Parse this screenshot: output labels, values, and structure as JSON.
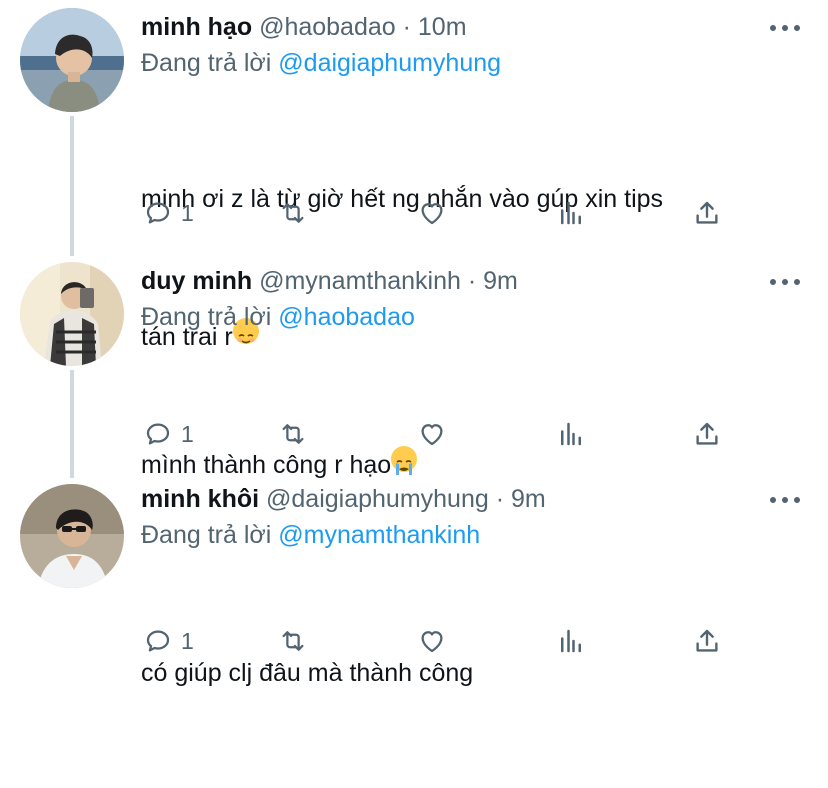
{
  "tweets": [
    {
      "name": "minh hạo",
      "handle": "@haobadao",
      "dot": "·",
      "time": "10m",
      "reply_prefix": "Đang trả lời ",
      "reply_to": "@daigiaphumyhung",
      "text_line1": "minh ơi z là từ giờ hết ng nhắn vào gúp xin tips",
      "text_line2": "tán trai r",
      "emoji": "relieved-face",
      "reply_count": "1"
    },
    {
      "name": "duy minh",
      "handle": "@mynamthankinh",
      "dot": "·",
      "time": "9m",
      "reply_prefix": "Đang trả lời ",
      "reply_to": "@haobadao",
      "text_line1": "mình thành công r hạo",
      "emoji": "crying-face",
      "reply_count": "1"
    },
    {
      "name": "minh khôi",
      "handle": "@daigiaphumyhung",
      "dot": "·",
      "time": "9m",
      "reply_prefix": "Đang trả lời ",
      "reply_to": "@mynamthankinh",
      "text_line1": "có giúp clj đâu mà thành công",
      "reply_count": "1"
    }
  ],
  "icons": [
    "reply-icon",
    "retweet-icon",
    "like-icon",
    "analytics-icon",
    "share-icon",
    "more-icon"
  ],
  "colors": {
    "link": "#1d9bf0",
    "secondary": "#536471",
    "thread_line": "#cfd9de"
  }
}
